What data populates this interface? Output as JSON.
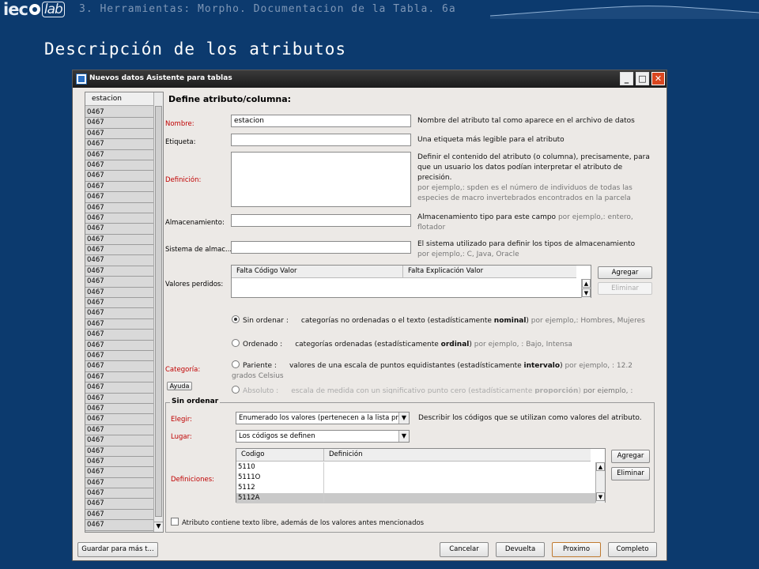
{
  "header": {
    "logo_text_1": "iec",
    "logo_text_2": "lab",
    "breadcrumb": "3. Herramientas: Morpho. Documentacion de la Tabla. 6a",
    "page_title": "Descripción de los atributos"
  },
  "window": {
    "title": "Nuevos datos Asistente para tablas",
    "minimize": "_",
    "maximize": "□",
    "close": "✕"
  },
  "left_list": {
    "header": "estacion",
    "rows": [
      "0467",
      "0467",
      "0467",
      "0467",
      "0467",
      "0467",
      "0467",
      "0467",
      "0467",
      "0467",
      "0467",
      "0467",
      "0467",
      "0467",
      "0467",
      "0467",
      "0467",
      "0467",
      "0467",
      "0467",
      "0467",
      "0467",
      "0467",
      "0467",
      "0467",
      "0467",
      "0467",
      "0467",
      "0467",
      "0467",
      "0467",
      "0467",
      "0467",
      "0467",
      "0467",
      "0467",
      "0467",
      "0467",
      "0467",
      "0467"
    ]
  },
  "form": {
    "heading": "Define atributo/columna:",
    "nombre": {
      "label": "Nombre:",
      "value": "estacion",
      "desc": "Nombre del atributo tal como aparece en el archivo de datos"
    },
    "etiqueta": {
      "label": "Etiqueta:",
      "value": "",
      "desc": "Una etiqueta más legible para el atributo"
    },
    "definicion": {
      "label": "Definición:",
      "value": "",
      "desc": "Definir el contenido del atributo (o columna), precisamente, para que un usuario los datos podían interpretar el atributo de precisión.",
      "example": "por ejemplo,: spden es el número de individuos de todas las especies de macro invertebrados encontrados en la parcela"
    },
    "almacenamiento": {
      "label": "Almacenamiento:",
      "value": "",
      "desc": "Almacenamiento tipo para este campo",
      "example": "por ejemplo,: entero, flotador"
    },
    "sistema": {
      "label": "Sistema de almac...",
      "value": "",
      "desc": "El sistema utilizado para definir los tipos de almacenamiento",
      "example": "por ejemplo,: C, Java, Oracle"
    },
    "valores_perdidos": {
      "label": "Valores perdidos:",
      "col1": "Falta Código Valor",
      "col2": "Falta Explicación Valor",
      "add": "Agregar",
      "remove": "Eliminar"
    },
    "categoria": {
      "label": "Categoría:",
      "help": "Ayuda"
    },
    "radios": [
      {
        "label": "Sin ordenar :",
        "text": "categorías no ordenadas o el texto (estadísticamente ",
        "bold": "nominal",
        "suffix": ")",
        "example": " por ejemplo,: Hombres, Mujeres",
        "checked": true
      },
      {
        "label": "Ordenado :",
        "text": "categorías ordenadas (estadísticamente ",
        "bold": "ordinal",
        "suffix": ")",
        "example": " por ejemplo, : Bajo, Intensa",
        "checked": false
      },
      {
        "label": "Pariente :",
        "text": "valores de una escala de puntos equidistantes (estadísticamente ",
        "bold": "intervalo",
        "suffix": ")",
        "example": " por ejemplo, : 12.2 grados Celsius",
        "checked": false
      },
      {
        "label": "Absoluto :",
        "text": "escala de medida con un significativo punto cero (estadísticamente ",
        "bold": "proporción",
        "suffix": ")",
        "example": " por ejemplo, :",
        "checked": false
      }
    ]
  },
  "sin_ordenar": {
    "legend": "Sin ordenar",
    "elegir_label": "Elegir:",
    "elegir_value": "Enumerado los valores (pertenecen a la lista pr...",
    "elegir_desc": "Describir los códigos que se utilizan como valores del atributo.",
    "lugar_label": "Lugar:",
    "lugar_value": "Los códigos se definen",
    "definiciones_label": "Definiciones:",
    "col_codigo": "Codigo",
    "col_definicion": "Definición",
    "codes": [
      "5110",
      "5111O",
      "5112",
      "5112A"
    ],
    "add": "Agregar",
    "remove": "Eliminar",
    "checkbox_label": "Atributo contiene texto libre, además de los valores antes mencionados"
  },
  "footer": {
    "save": "Guardar para más t...",
    "cancel": "Cancelar",
    "back": "Devuelta",
    "next": "Proximo",
    "finish": "Completo"
  }
}
